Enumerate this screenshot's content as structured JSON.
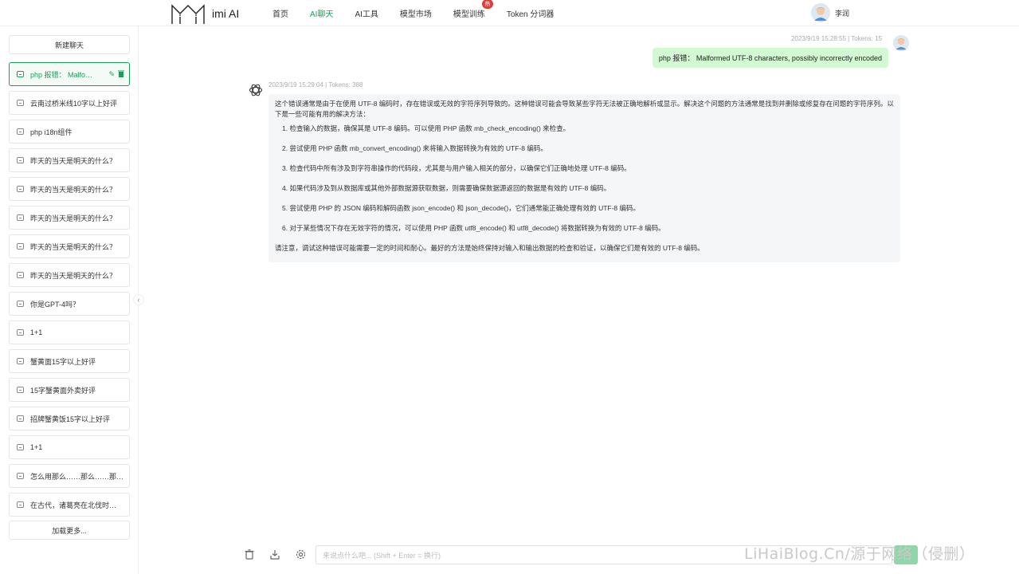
{
  "app": {
    "name": "imi AI",
    "user_name": "李润"
  },
  "nav": [
    "首页",
    "AI聊天",
    "AI工具",
    "模型市场",
    "模型训练",
    "Token 分词器"
  ],
  "nav_badge": "热",
  "colors": {
    "accent": "#18a058",
    "user_bubble": "#d2f9d1",
    "answer_bg": "#f4f6f8"
  },
  "sidebar": {
    "new_chat": "新建聊天",
    "items": [
      "php 报错： Malfo…",
      "云南过桥米线10字以上好评",
      "php i18n组件",
      "昨天的当天是明天的什么？",
      "昨天的当天是明天的什么？",
      "昨天的当天是明天的什么？",
      "昨天的当天是明天的什么？",
      "昨天的当天是明天的什么？",
      "你是GPT-4吗？",
      "1+1",
      "蟹黄面15字以上好评",
      "15字蟹黄面外卖好评",
      "招牌蟹黄饭15字以上好评",
      "1+1",
      "怎么用那么……那么……那…",
      "在古代，诸葛亮在北伐时…"
    ],
    "load_more": "加载更多..."
  },
  "chat": {
    "user_meta": "2023/9/19 15:28:55 | Tokens: 15",
    "user_message": "php 报错： Malformed UTF-8 characters, possibly incorrectly encoded",
    "ai_meta": "2023/9/19 15:29:04 | Tokens: 388",
    "ai_intro": "这个错误通常是由于在使用 UTF-8 编码时，存在错误或无效的字符序列导致的。这种错误可能会导致某些字符无法被正确地解析或显示。解决这个问题的方法通常是找到并删除或修复存在问题的字符序列。以下是一些可能有用的解决方法：",
    "ai_steps": [
      "1. 检查输入的数据，确保其是 UTF-8 编码。可以使用 PHP 函数 mb_check_encoding() 来检查。",
      "2. 尝试使用 PHP 函数 mb_convert_encoding() 来将输入数据转换为有效的 UTF-8 编码。",
      "3. 检查代码中所有涉及到字符串操作的代码段，尤其是与用户输入相关的部分，以确保它们正确地处理 UTF-8 编码。",
      "4. 如果代码涉及到从数据库或其他外部数据源获取数据，则需要确保数据源返回的数据是有效的 UTF-8 编码。",
      "5. 尝试使用 PHP 的 JSON 编码和解码函数 json_encode() 和 json_decode()，它们通常能正确处理有效的 UTF-8 编码。",
      "6. 对于某些情况下存在无效字符的情况，可以使用 PHP 函数 utf8_encode() 和 utf8_decode() 将数据转换为有效的 UTF-8 编码。"
    ],
    "ai_outro": "请注意，调试这种错误可能需要一定的时间和耐心。最好的方法是始终保持对输入和输出数据的检查和验证，以确保它们是有效的 UTF-8 编码。"
  },
  "input": {
    "placeholder": "来说点什么吧... (Shift + Enter = 换行)"
  },
  "watermark": "LiHaiBlog.Cn/源于网络（侵删）"
}
